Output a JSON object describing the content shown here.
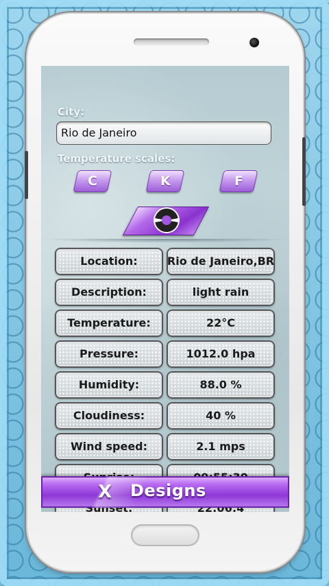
{
  "form": {
    "city_label": "City:",
    "city_value": "Rio de Janeiro",
    "scales_label": "Temperature scales:",
    "scales": [
      "C",
      "K",
      "F"
    ]
  },
  "refresh_icon": "refresh-icon",
  "weather": {
    "rows": [
      {
        "label": "Location:",
        "value": "Rio de Janeiro,BR"
      },
      {
        "label": "Description:",
        "value": "light rain"
      },
      {
        "label": "Temperature:",
        "value": "22°C"
      },
      {
        "label": "Pressure:",
        "value": "1012.0 hpa"
      },
      {
        "label": "Humidity:",
        "value": "88.0 %"
      },
      {
        "label": "Cloudiness:",
        "value": "40 %"
      },
      {
        "label": "Wind speed:",
        "value": "2.1 mps"
      },
      {
        "label": "Sunrise:",
        "value": "09:55:30"
      },
      {
        "label": "Sunset:",
        "value": "22:06:4"
      }
    ]
  },
  "banner": {
    "logo": "X",
    "text": "Designs"
  },
  "colors": {
    "accent": "#9b5ad6",
    "background": "#7ec4e2"
  }
}
